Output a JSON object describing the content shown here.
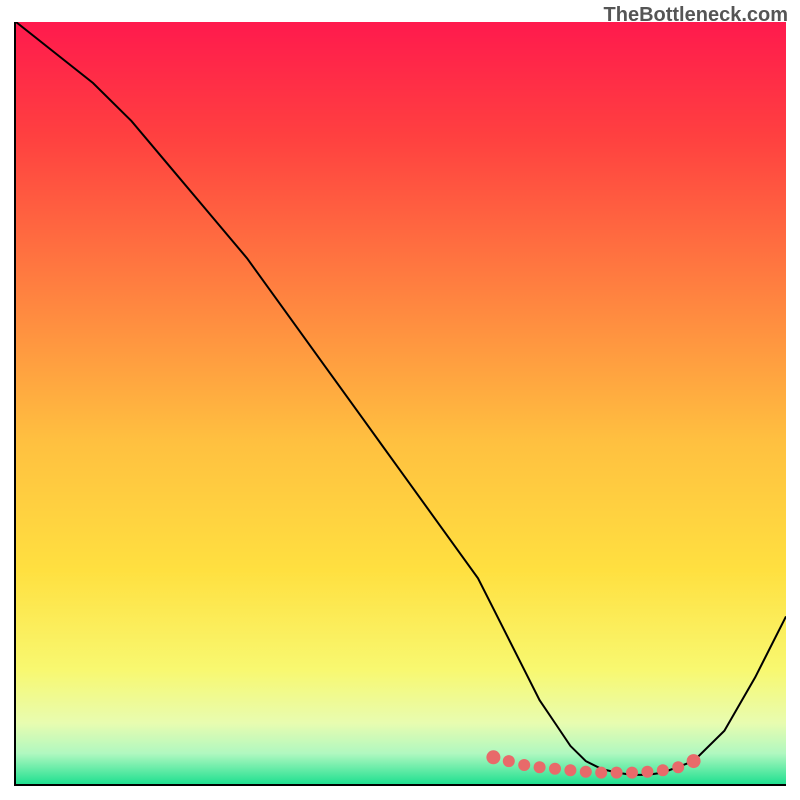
{
  "watermark": "TheBottleneck.com",
  "chart_data": {
    "type": "line",
    "title": "",
    "xlabel": "",
    "ylabel": "",
    "xlim": [
      0,
      100
    ],
    "ylim": [
      0,
      100
    ],
    "series": [
      {
        "name": "curve",
        "x": [
          0,
          5,
          10,
          15,
          20,
          25,
          30,
          35,
          40,
          45,
          50,
          55,
          60,
          62,
          64,
          66,
          68,
          70,
          72,
          74,
          76,
          78,
          80,
          82,
          84,
          88,
          92,
          96,
          100
        ],
        "values": [
          100,
          96,
          92,
          87,
          81,
          75,
          69,
          62,
          55,
          48,
          41,
          34,
          27,
          23,
          19,
          15,
          11,
          8,
          5,
          3,
          2,
          1.5,
          1.2,
          1.2,
          1.5,
          3,
          7,
          14,
          22
        ]
      },
      {
        "name": "highlight-dots",
        "x": [
          62,
          64,
          66,
          68,
          70,
          72,
          74,
          76,
          78,
          80,
          82,
          84,
          86,
          88
        ],
        "values": [
          3.5,
          3.0,
          2.5,
          2.2,
          2.0,
          1.8,
          1.6,
          1.5,
          1.5,
          1.5,
          1.6,
          1.8,
          2.2,
          3.0
        ]
      }
    ],
    "gradient_stops": [
      {
        "offset": 0,
        "color": "#ff1a4d"
      },
      {
        "offset": 0.15,
        "color": "#ff4040"
      },
      {
        "offset": 0.35,
        "color": "#ff8040"
      },
      {
        "offset": 0.55,
        "color": "#ffc040"
      },
      {
        "offset": 0.72,
        "color": "#ffe040"
      },
      {
        "offset": 0.85,
        "color": "#f8f870"
      },
      {
        "offset": 0.92,
        "color": "#e8fcb0"
      },
      {
        "offset": 0.96,
        "color": "#b0f8c0"
      },
      {
        "offset": 1.0,
        "color": "#20e090"
      }
    ],
    "highlight_color": "#e86a6a",
    "curve_color": "#000000"
  }
}
